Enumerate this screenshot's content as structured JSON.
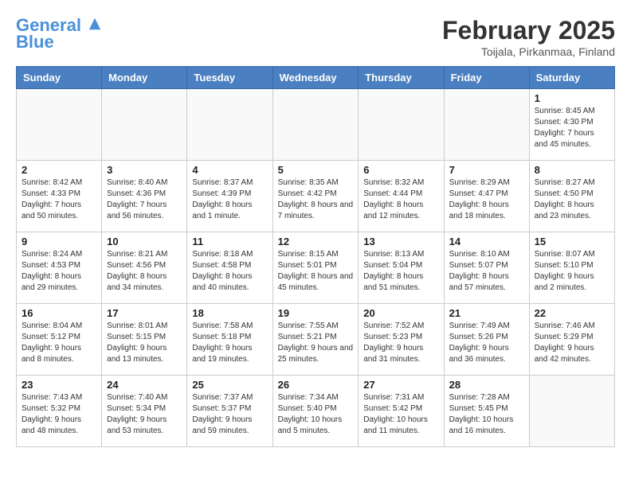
{
  "header": {
    "logo_line1": "General",
    "logo_line2": "Blue",
    "month_title": "February 2025",
    "subtitle": "Toijala, Pirkanmaa, Finland"
  },
  "days_of_week": [
    "Sunday",
    "Monday",
    "Tuesday",
    "Wednesday",
    "Thursday",
    "Friday",
    "Saturday"
  ],
  "weeks": [
    [
      {
        "day": "",
        "info": ""
      },
      {
        "day": "",
        "info": ""
      },
      {
        "day": "",
        "info": ""
      },
      {
        "day": "",
        "info": ""
      },
      {
        "day": "",
        "info": ""
      },
      {
        "day": "",
        "info": ""
      },
      {
        "day": "1",
        "info": "Sunrise: 8:45 AM\nSunset: 4:30 PM\nDaylight: 7 hours and 45 minutes."
      }
    ],
    [
      {
        "day": "2",
        "info": "Sunrise: 8:42 AM\nSunset: 4:33 PM\nDaylight: 7 hours and 50 minutes."
      },
      {
        "day": "3",
        "info": "Sunrise: 8:40 AM\nSunset: 4:36 PM\nDaylight: 7 hours and 56 minutes."
      },
      {
        "day": "4",
        "info": "Sunrise: 8:37 AM\nSunset: 4:39 PM\nDaylight: 8 hours and 1 minute."
      },
      {
        "day": "5",
        "info": "Sunrise: 8:35 AM\nSunset: 4:42 PM\nDaylight: 8 hours and 7 minutes."
      },
      {
        "day": "6",
        "info": "Sunrise: 8:32 AM\nSunset: 4:44 PM\nDaylight: 8 hours and 12 minutes."
      },
      {
        "day": "7",
        "info": "Sunrise: 8:29 AM\nSunset: 4:47 PM\nDaylight: 8 hours and 18 minutes."
      },
      {
        "day": "8",
        "info": "Sunrise: 8:27 AM\nSunset: 4:50 PM\nDaylight: 8 hours and 23 minutes."
      }
    ],
    [
      {
        "day": "9",
        "info": "Sunrise: 8:24 AM\nSunset: 4:53 PM\nDaylight: 8 hours and 29 minutes."
      },
      {
        "day": "10",
        "info": "Sunrise: 8:21 AM\nSunset: 4:56 PM\nDaylight: 8 hours and 34 minutes."
      },
      {
        "day": "11",
        "info": "Sunrise: 8:18 AM\nSunset: 4:58 PM\nDaylight: 8 hours and 40 minutes."
      },
      {
        "day": "12",
        "info": "Sunrise: 8:15 AM\nSunset: 5:01 PM\nDaylight: 8 hours and 45 minutes."
      },
      {
        "day": "13",
        "info": "Sunrise: 8:13 AM\nSunset: 5:04 PM\nDaylight: 8 hours and 51 minutes."
      },
      {
        "day": "14",
        "info": "Sunrise: 8:10 AM\nSunset: 5:07 PM\nDaylight: 8 hours and 57 minutes."
      },
      {
        "day": "15",
        "info": "Sunrise: 8:07 AM\nSunset: 5:10 PM\nDaylight: 9 hours and 2 minutes."
      }
    ],
    [
      {
        "day": "16",
        "info": "Sunrise: 8:04 AM\nSunset: 5:12 PM\nDaylight: 9 hours and 8 minutes."
      },
      {
        "day": "17",
        "info": "Sunrise: 8:01 AM\nSunset: 5:15 PM\nDaylight: 9 hours and 13 minutes."
      },
      {
        "day": "18",
        "info": "Sunrise: 7:58 AM\nSunset: 5:18 PM\nDaylight: 9 hours and 19 minutes."
      },
      {
        "day": "19",
        "info": "Sunrise: 7:55 AM\nSunset: 5:21 PM\nDaylight: 9 hours and 25 minutes."
      },
      {
        "day": "20",
        "info": "Sunrise: 7:52 AM\nSunset: 5:23 PM\nDaylight: 9 hours and 31 minutes."
      },
      {
        "day": "21",
        "info": "Sunrise: 7:49 AM\nSunset: 5:26 PM\nDaylight: 9 hours and 36 minutes."
      },
      {
        "day": "22",
        "info": "Sunrise: 7:46 AM\nSunset: 5:29 PM\nDaylight: 9 hours and 42 minutes."
      }
    ],
    [
      {
        "day": "23",
        "info": "Sunrise: 7:43 AM\nSunset: 5:32 PM\nDaylight: 9 hours and 48 minutes."
      },
      {
        "day": "24",
        "info": "Sunrise: 7:40 AM\nSunset: 5:34 PM\nDaylight: 9 hours and 53 minutes."
      },
      {
        "day": "25",
        "info": "Sunrise: 7:37 AM\nSunset: 5:37 PM\nDaylight: 9 hours and 59 minutes."
      },
      {
        "day": "26",
        "info": "Sunrise: 7:34 AM\nSunset: 5:40 PM\nDaylight: 10 hours and 5 minutes."
      },
      {
        "day": "27",
        "info": "Sunrise: 7:31 AM\nSunset: 5:42 PM\nDaylight: 10 hours and 11 minutes."
      },
      {
        "day": "28",
        "info": "Sunrise: 7:28 AM\nSunset: 5:45 PM\nDaylight: 10 hours and 16 minutes."
      },
      {
        "day": "",
        "info": ""
      }
    ]
  ]
}
